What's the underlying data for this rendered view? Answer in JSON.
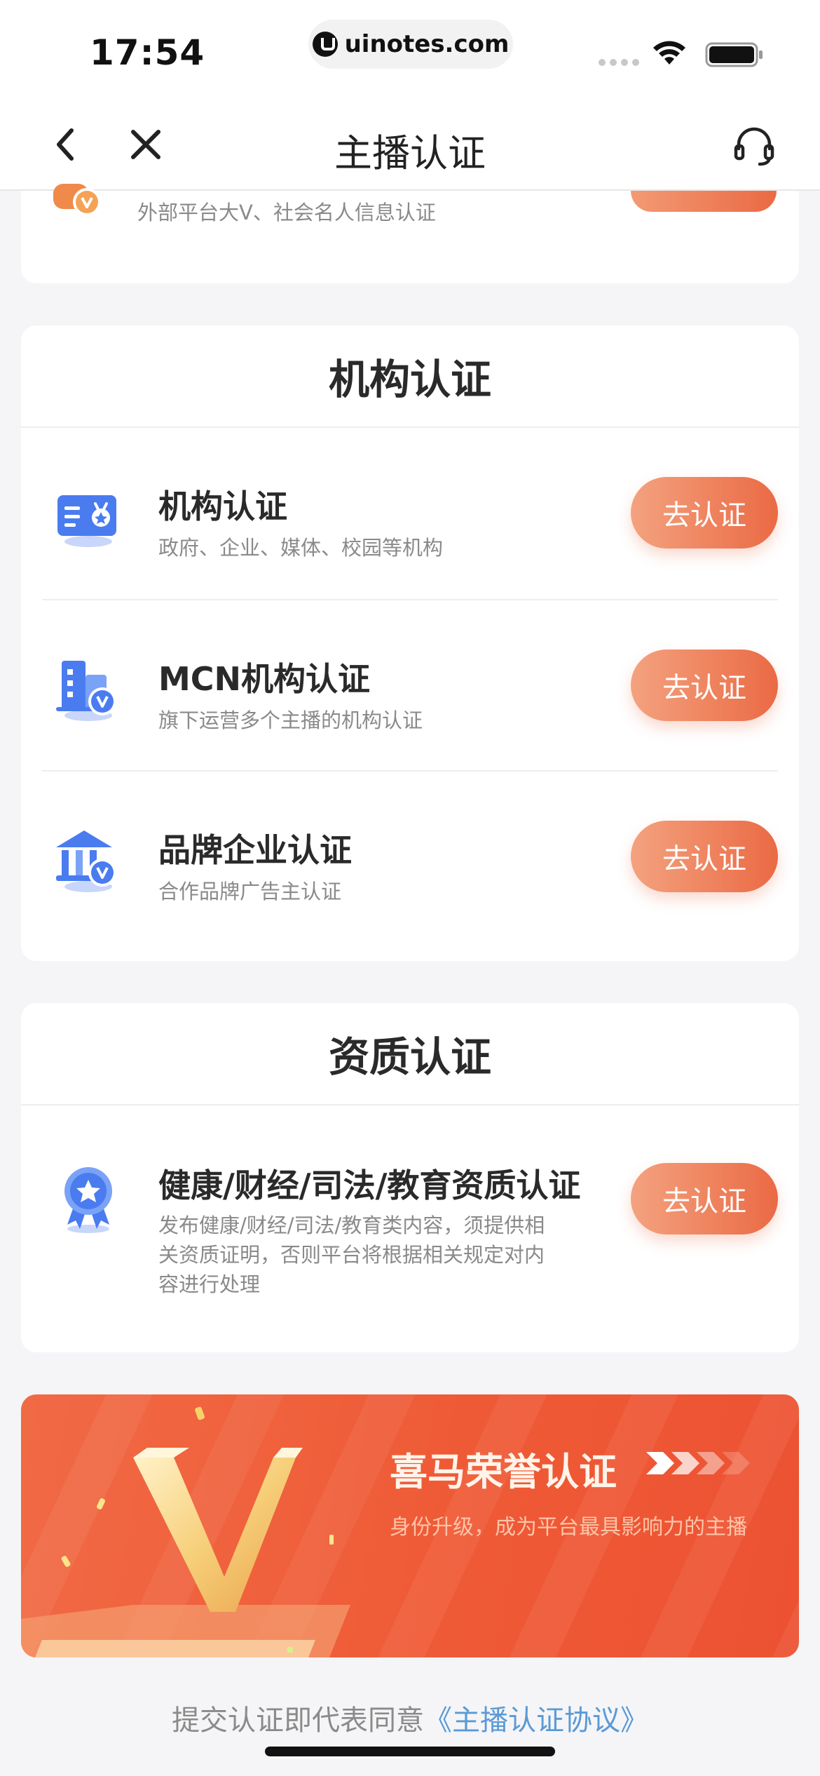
{
  "status_bar": {
    "time": "17:54",
    "url": "uinotes.com"
  },
  "nav": {
    "title": "主播认证"
  },
  "partial_card": {
    "subtitle": "外部平台大V、社会名人信息认证"
  },
  "org_section": {
    "header": "机构认证",
    "items": [
      {
        "title": "机构认证",
        "subtitle": "政府、企业、媒体、校园等机构",
        "button": "去认证",
        "icon": "id-card-icon"
      },
      {
        "title": "MCN机构认证",
        "subtitle": "旗下运营多个主播的机构认证",
        "button": "去认证",
        "icon": "building-icon"
      },
      {
        "title": "品牌企业认证",
        "subtitle": "合作品牌广告主认证",
        "button": "去认证",
        "icon": "bank-icon"
      }
    ]
  },
  "qual_section": {
    "header": "资质认证",
    "items": [
      {
        "title": "健康/财经/司法/教育资质认证",
        "subtitle": "发布健康/财经/司法/教育类内容，须提供相关资质证明，否则平台将根据相关规定对内容进行处理",
        "button": "去认证",
        "icon": "badge-icon"
      }
    ]
  },
  "banner": {
    "title": "喜马荣誉认证",
    "subtitle": "身份升级，成为平台最具影响力的主播"
  },
  "footer": {
    "agreement_prefix": "提交认证即代表同意",
    "agreement_link": "《主播认证协议》"
  },
  "colors": {
    "accent": "#ea6a44",
    "link": "#5a9ad6",
    "icon_blue": "#4a7cf0"
  }
}
